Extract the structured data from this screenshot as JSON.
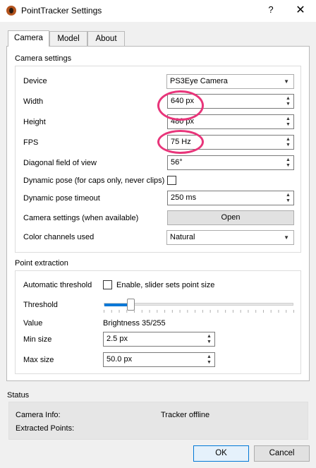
{
  "window": {
    "title": "PointTracker Settings",
    "help": "?",
    "close": "✕"
  },
  "tabs": [
    {
      "label": "Camera",
      "active": true
    },
    {
      "label": "Model",
      "active": false
    },
    {
      "label": "About",
      "active": false
    }
  ],
  "camera_settings": {
    "title": "Camera settings",
    "device": {
      "label": "Device",
      "value": "PS3Eye Camera"
    },
    "width": {
      "label": "Width",
      "value": "640 px"
    },
    "height": {
      "label": "Height",
      "value": "480 px"
    },
    "fps": {
      "label": "FPS",
      "value": "75 Hz"
    },
    "fov": {
      "label": "Diagonal field of view",
      "value": "56°"
    },
    "dynamic_pose": {
      "label": "Dynamic pose (for caps only, never clips)",
      "checked": false
    },
    "dynamic_pose_timeout": {
      "label": "Dynamic pose timeout",
      "value": "250 ms"
    },
    "camera_settings_open": {
      "label": "Camera settings (when available)",
      "button": "Open"
    },
    "color_channels": {
      "label": "Color channels used",
      "value": "Natural"
    }
  },
  "point_extraction": {
    "title": "Point extraction",
    "auto_threshold": {
      "label": "Automatic threshold",
      "checkbox_label": "Enable, slider sets point size",
      "checked": false
    },
    "threshold": {
      "label": "Threshold",
      "level": 0.14
    },
    "value": {
      "label": "Value",
      "text": "Brightness 35/255"
    },
    "min_size": {
      "label": "Min size",
      "value": "2.5 px"
    },
    "max_size": {
      "label": "Max size",
      "value": "50.0 px"
    }
  },
  "status": {
    "title": "Status",
    "camera_info_label": "Camera Info:",
    "camera_info_value": "Tracker offline",
    "extracted_points_label": "Extracted Points:"
  },
  "buttons": {
    "ok": "OK",
    "cancel": "Cancel"
  },
  "colors": {
    "accent": "#0a78d7",
    "highlight_circle": "#e8357a"
  }
}
